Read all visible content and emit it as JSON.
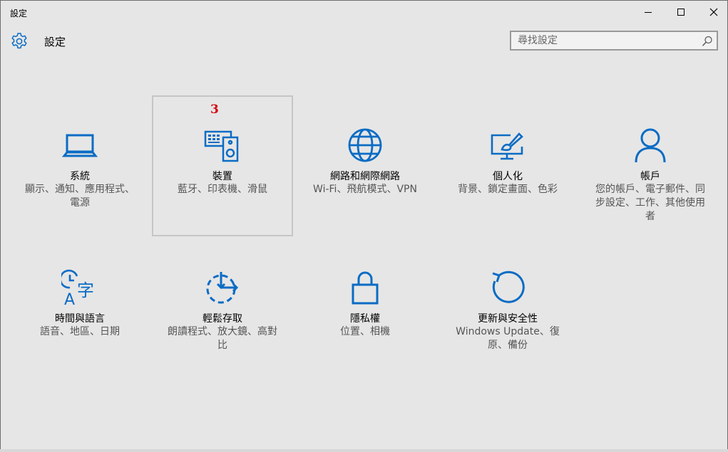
{
  "window": {
    "title": "設定"
  },
  "header": {
    "title": "設定",
    "icon": "gear-icon"
  },
  "search": {
    "placeholder": "尋找設定",
    "value": ""
  },
  "colors": {
    "accent": "#0a6cc4",
    "background": "#e6e6e6",
    "badge": "#d4000f"
  },
  "badge": "3",
  "tiles": [
    {
      "label": "系統",
      "desc": "顯示、通知、應用程式、電源",
      "icon": "laptop-icon"
    },
    {
      "label": "裝置",
      "desc": "藍牙、印表機、滑鼠",
      "icon": "devices-icon"
    },
    {
      "label": "網路和網際網路",
      "desc": "Wi-Fi、飛航模式、VPN",
      "icon": "globe-icon"
    },
    {
      "label": "個人化",
      "desc": "背景、鎖定畫面、色彩",
      "icon": "paintbrush-monitor-icon"
    },
    {
      "label": "帳戶",
      "desc": "您的帳戶、電子郵件、同步設定、工作、其他使用者",
      "icon": "person-icon"
    },
    {
      "label": "時間與語言",
      "desc": "語音、地區、日期",
      "icon": "time-language-icon"
    },
    {
      "label": "輕鬆存取",
      "desc": "朗讀程式、放大鏡、高對比",
      "icon": "ease-of-access-icon"
    },
    {
      "label": "隱私權",
      "desc": "位置、相機",
      "icon": "lock-icon"
    },
    {
      "label": "更新與安全性",
      "desc": "Windows Update、復原、備份",
      "icon": "update-refresh-icon"
    }
  ]
}
